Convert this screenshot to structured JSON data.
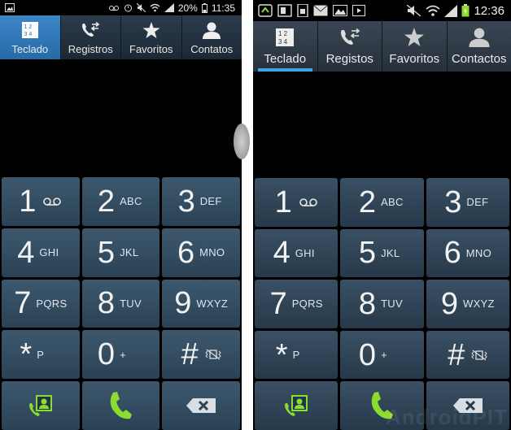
{
  "left": {
    "status": {
      "battery": "20%",
      "time": "11:35"
    },
    "tabs": [
      {
        "label": "Teclado",
        "icon": "keypad-icon"
      },
      {
        "label": "Registros",
        "icon": "call-log-icon"
      },
      {
        "label": "Favoritos",
        "icon": "star-icon"
      },
      {
        "label": "Contatos",
        "icon": "person-icon"
      }
    ],
    "keys": [
      {
        "digit": "1",
        "sub": ""
      },
      {
        "digit": "2",
        "sub": "ABC"
      },
      {
        "digit": "3",
        "sub": "DEF"
      },
      {
        "digit": "4",
        "sub": "GHI"
      },
      {
        "digit": "5",
        "sub": "JKL"
      },
      {
        "digit": "6",
        "sub": "MNO"
      },
      {
        "digit": "7",
        "sub": "PQRS"
      },
      {
        "digit": "8",
        "sub": "TUV"
      },
      {
        "digit": "9",
        "sub": "WXYZ"
      },
      {
        "digit": "*",
        "sub": "P"
      },
      {
        "digit": "0",
        "sub": "+"
      },
      {
        "digit": "#",
        "sub": ""
      }
    ]
  },
  "right": {
    "status": {
      "time": "12:36"
    },
    "tabs": [
      {
        "label": "Teclado",
        "icon": "keypad-icon"
      },
      {
        "label": "Registos",
        "icon": "call-log-icon"
      },
      {
        "label": "Favoritos",
        "icon": "star-icon"
      },
      {
        "label": "Contactos",
        "icon": "person-icon"
      }
    ],
    "keys": [
      {
        "digit": "1",
        "sub": ""
      },
      {
        "digit": "2",
        "sub": "ABC"
      },
      {
        "digit": "3",
        "sub": "DEF"
      },
      {
        "digit": "4",
        "sub": "GHI"
      },
      {
        "digit": "5",
        "sub": "JKL"
      },
      {
        "digit": "6",
        "sub": "MNO"
      },
      {
        "digit": "7",
        "sub": "PQRS"
      },
      {
        "digit": "8",
        "sub": "TUV"
      },
      {
        "digit": "9",
        "sub": "WXYZ"
      },
      {
        "digit": "*",
        "sub": "P"
      },
      {
        "digit": "0",
        "sub": "+"
      },
      {
        "digit": "#",
        "sub": ""
      }
    ],
    "watermark": "AndroidPIT"
  },
  "colors": {
    "active_tab": "#2f7dc0",
    "accent_underline": "#39a8e0",
    "call_green": "#8bdc2f"
  }
}
